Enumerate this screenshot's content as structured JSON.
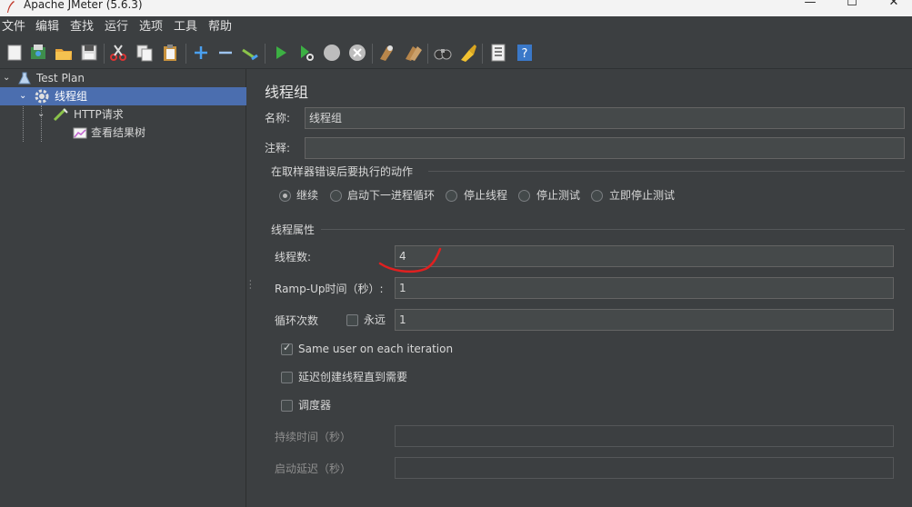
{
  "window": {
    "title": "Apache JMeter (5.6.3)",
    "controls": [
      "—",
      "☐",
      "✕"
    ]
  },
  "menu": [
    "文件",
    "编辑",
    "查找",
    "运行",
    "选项",
    "工具",
    "帮助"
  ],
  "toolbar_icons": [
    "new-icon",
    "templates-icon",
    "open-icon",
    "save-icon",
    "cut-icon",
    "copy-icon",
    "paste-icon",
    "expand-icon",
    "collapse-icon",
    "toggle-icon",
    "start-icon",
    "start-no-pause-icon",
    "stop-icon",
    "shutdown-icon",
    "clear-icon",
    "clear-all-icon",
    "search-icon",
    "reset-search-icon",
    "function-helper-icon",
    "help-icon"
  ],
  "tree": {
    "items": [
      {
        "label": "Test Plan"
      },
      {
        "label": "线程组"
      },
      {
        "label": "HTTP请求"
      },
      {
        "label": "查看结果树"
      }
    ]
  },
  "panel": {
    "title": "线程组",
    "name_label": "名称:",
    "name_value": "线程组",
    "comment_label": "注释:",
    "comment_value": "",
    "error_group_title": "在取样器错误后要执行的动作",
    "error_options": [
      "继续",
      "启动下一进程循环",
      "停止线程",
      "停止测试",
      "立即停止测试"
    ],
    "error_selected": "继续",
    "thread_group_title": "线程属性",
    "threads_label": "线程数:",
    "threads_value": "4",
    "rampup_label": "Ramp-Up时间（秒）:",
    "rampup_value": "1",
    "loop_label": "循环次数",
    "forever_label": "永远",
    "loop_value": "1",
    "same_user_label": "Same user on each iteration",
    "delay_label": "延迟创建线程直到需要",
    "scheduler_label": "调度器",
    "duration_label": "持续时间（秒）",
    "duration_value": "",
    "startup_delay_label": "启动延迟（秒）",
    "startup_delay_value": ""
  },
  "colors": {
    "background": "#3c3f41",
    "selection": "#4b6eaf",
    "annotation": "#e02020"
  }
}
